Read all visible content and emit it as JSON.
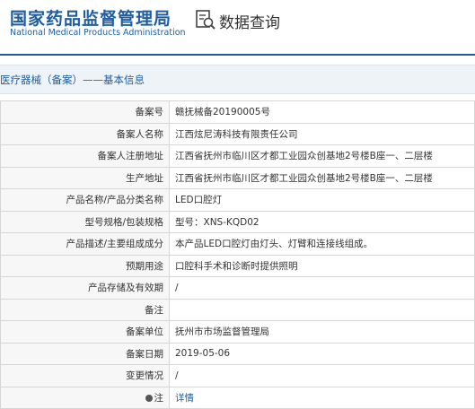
{
  "header": {
    "org_name_cn": "国家药品监督管理局",
    "org_name_en": "National Medical Products Administration",
    "section_title": "数据查询"
  },
  "breadcrumb": "医疗器械（备案）——基本信息",
  "rows": [
    {
      "label": "备案号",
      "value": "赣抚械备20190005号"
    },
    {
      "label": "备案人名称",
      "value": "江西炫尼涛科技有限责任公司"
    },
    {
      "label": "备案人注册地址",
      "value": "江西省抚州市临川区才都工业园众创基地2号楼B座一、二层楼"
    },
    {
      "label": "生产地址",
      "value": "江西省抚州市临川区才都工业园众创基地2号楼B座一、二层楼"
    },
    {
      "label": "产品名称/产品分类名称",
      "value": "LED口腔灯"
    },
    {
      "label": "型号规格/包装规格",
      "value": "型号：XNS-KQD02"
    },
    {
      "label": "产品描述/主要组成成分",
      "value": "本产品LED口腔灯由灯头、灯臂和连接线组成。"
    },
    {
      "label": "预期用途",
      "value": "口腔科手术和诊断时提供照明"
    },
    {
      "label": "产品存储及有效期",
      "value": "/"
    },
    {
      "label": "备注",
      "value": ""
    },
    {
      "label": "备案单位",
      "value": "抚州市市场监督管理局"
    },
    {
      "label": "备案日期",
      "value": "2019-05-06"
    },
    {
      "label": "变更情况",
      "value": "/"
    },
    {
      "label": "注",
      "value": "详情"
    }
  ]
}
